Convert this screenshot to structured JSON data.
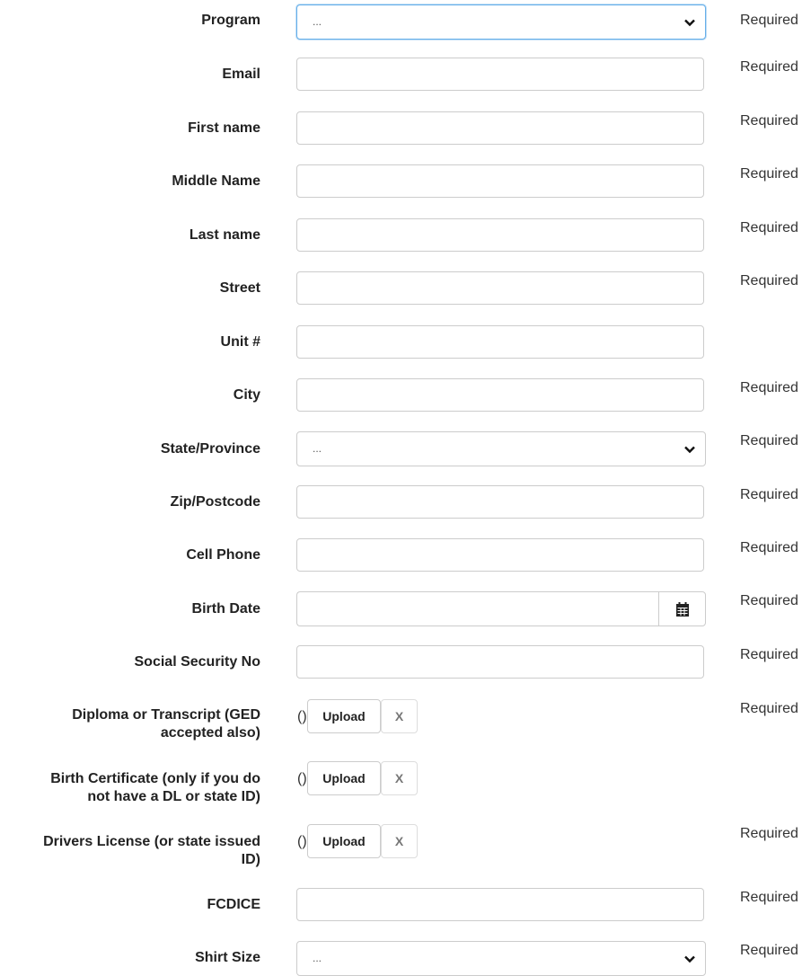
{
  "required_text": "Required",
  "select_placeholder": "...",
  "upload_label": "Upload",
  "clear_label": "X",
  "paren_text": "()",
  "fields": {
    "program": "Program",
    "email": "Email",
    "first_name": "First name",
    "middle_name": "Middle Name",
    "last_name": "Last name",
    "street": "Street",
    "unit": "Unit #",
    "city": "City",
    "state": "State/Province",
    "zip": "Zip/Postcode",
    "cell": "Cell Phone",
    "birth_date": "Birth Date",
    "ssn": "Social Security No",
    "diploma_1": "Diploma or Transcript (GED",
    "diploma_2": "accepted also)",
    "birth_cert_1": "Birth Certificate (only if you do",
    "birth_cert_2": "not have a DL or state ID)",
    "license_1": "Drivers License (or state issued",
    "license_2": "ID)",
    "fcdice": "FCDICE",
    "shirt": "Shirt Size"
  },
  "icons": {
    "select_arrow": "chevron-down-icon",
    "date_picker": "calendar-icon"
  }
}
